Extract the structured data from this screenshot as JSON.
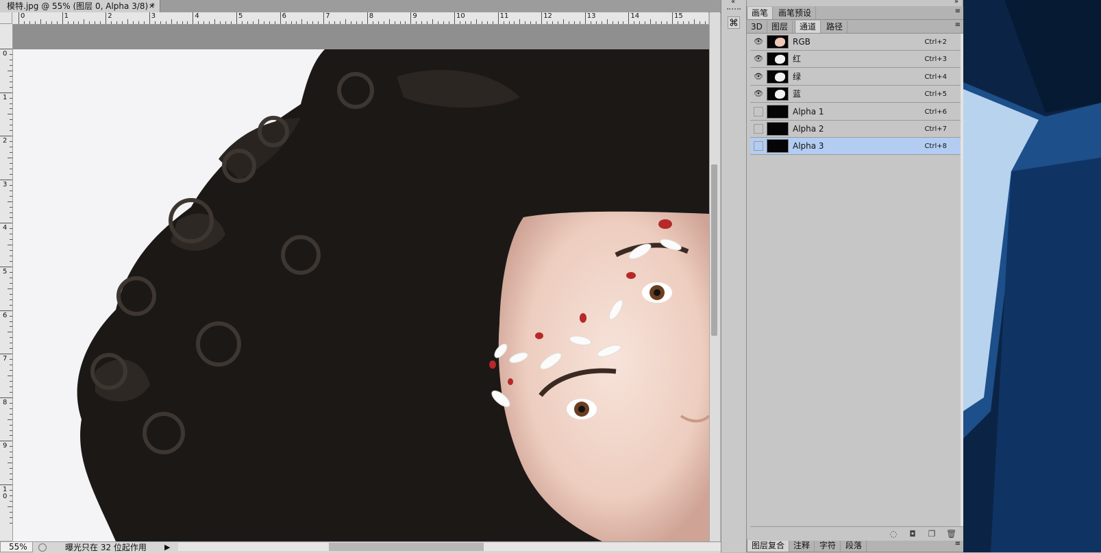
{
  "document": {
    "tab_title": "模特.jpg @ 55% (图层 0, Alpha 3/8) *",
    "close_glyph": "×"
  },
  "rulers": {
    "top_labels": [
      "0",
      "1",
      "2",
      "3",
      "4",
      "5",
      "6",
      "7",
      "8",
      "9",
      "10",
      "11",
      "12",
      "13",
      "14",
      "15"
    ],
    "left_labels": [
      "0",
      "1",
      "2",
      "3",
      "4",
      "5",
      "6",
      "7",
      "8",
      "9",
      "1\n0"
    ]
  },
  "status_bar": {
    "zoom": "55%",
    "info": "曝光只在 32 位起作用"
  },
  "panel": {
    "top_tabs": [
      "画笔",
      "画笔预设"
    ],
    "tabs": [
      "3D",
      "图层",
      "通道",
      "路径"
    ],
    "active_tab": "通道",
    "bottom_tabs": [
      "图层复合",
      "注释",
      "字符",
      "段落"
    ],
    "collapse_glyph": "»",
    "menu_glyph": "≡"
  },
  "dock": {
    "collapse_glyph": "«"
  },
  "channels": [
    {
      "name": "RGB",
      "shortcut": "Ctrl+2",
      "visible": true,
      "selected": false,
      "thumb": "rgb"
    },
    {
      "name": "红",
      "shortcut": "Ctrl+3",
      "visible": true,
      "selected": false,
      "thumb": "gray"
    },
    {
      "name": "绿",
      "shortcut": "Ctrl+4",
      "visible": true,
      "selected": false,
      "thumb": "gray"
    },
    {
      "name": "蓝",
      "shortcut": "Ctrl+5",
      "visible": true,
      "selected": false,
      "thumb": "gray"
    },
    {
      "name": "Alpha 1",
      "shortcut": "Ctrl+6",
      "visible": false,
      "selected": false,
      "thumb": "black"
    },
    {
      "name": "Alpha 2",
      "shortcut": "Ctrl+7",
      "visible": false,
      "selected": false,
      "thumb": "black"
    },
    {
      "name": "Alpha 3",
      "shortcut": "Ctrl+8",
      "visible": false,
      "selected": true,
      "thumb": "black"
    }
  ],
  "channel_icons": [
    "load-selection-icon",
    "save-selection-icon",
    "new-channel-icon",
    "trash-icon"
  ],
  "colors": {
    "selection": "#b3cdf2",
    "panel_bg": "#c6c6c6",
    "hair": "#1a1614",
    "skin": "#efd3c6",
    "desktop": "#0d2b52"
  }
}
